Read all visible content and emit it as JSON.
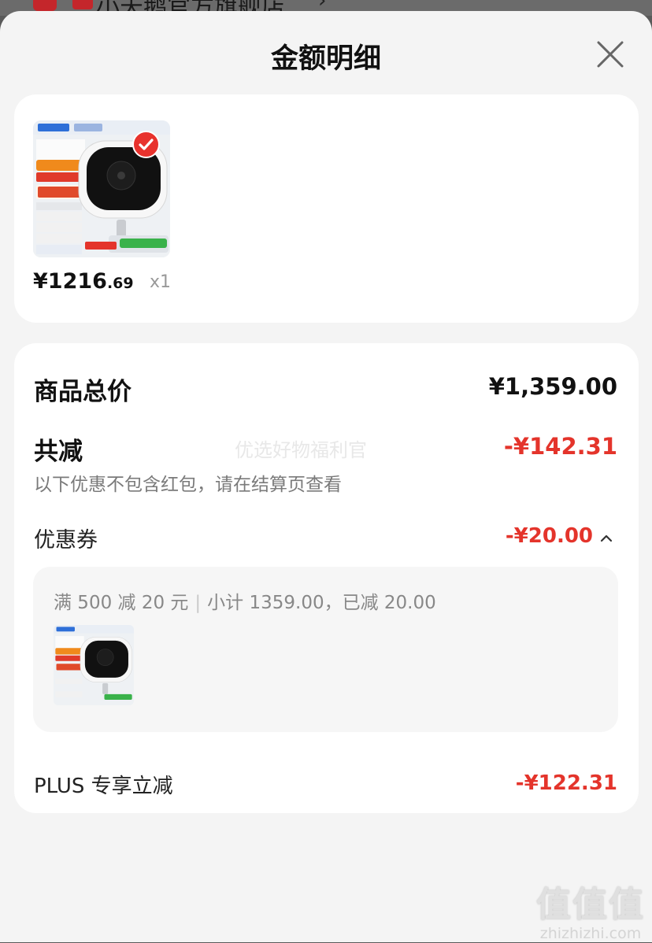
{
  "background": {
    "shop_name": "小天鹅官方旗舰店",
    "chevron": "›"
  },
  "sheet": {
    "title": "金额明细",
    "close_icon": "close-icon"
  },
  "product": {
    "price_int": "¥1216",
    "price_dec": ".69",
    "quantity": "x1",
    "selected": true
  },
  "summary": {
    "total_label": "商品总价",
    "total_value": "¥1,359.00",
    "reduce_label": "共减",
    "reduce_value": "-¥142.31",
    "note": "以下优惠不包含红包，请在结算页查看",
    "watermark": "优选好物福利官"
  },
  "coupon": {
    "label": "优惠券",
    "value": "-¥20.00",
    "expanded": true,
    "rule": "满 500 减 20 元",
    "subtotal": "小计 1359.00，已减 20.00"
  },
  "plus": {
    "label": "PLUS 专享立减",
    "value": "-¥122.31"
  },
  "site_watermark": {
    "glyphs": "值值值",
    "domain": "zhizhizhi.com"
  },
  "colors": {
    "accent_red": "#e4342b",
    "sheet_bg": "#f4f4f4",
    "card_bg": "#ffffff"
  }
}
